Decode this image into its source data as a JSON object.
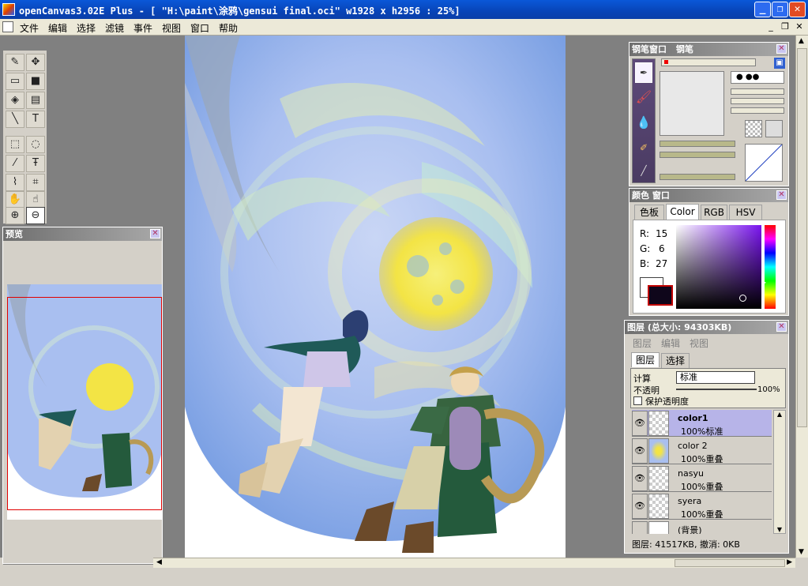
{
  "window": {
    "title": "openCanvas3.02E Plus - [ \"H:\\paint\\涂鸦\\gensui final.oci\" w1928 x h2956 : 25%]"
  },
  "menu": [
    "文件",
    "编辑",
    "选择",
    "滤镜",
    "事件",
    "视图",
    "窗口",
    "帮助"
  ],
  "preview": {
    "title": "预览"
  },
  "brush": {
    "title": "钢笔窗口",
    "tool_name": "钢笔"
  },
  "color": {
    "title": "颜色 窗口",
    "tabs": [
      "色板",
      "Color",
      "RGB",
      "HSV"
    ],
    "selected_tab": "Color",
    "r_label": "R:",
    "r": "15",
    "g_label": "G:",
    "g": "6",
    "b_label": "B:",
    "b": "27",
    "fg_color": "#0f061b",
    "bg_color": "#ffffff"
  },
  "layers": {
    "title": "图层 (总大小: 94303KB)",
    "menu": [
      "图层",
      "编辑",
      "视图"
    ],
    "tabs": [
      "图层",
      "选择"
    ],
    "blend_label": "计算",
    "blend_mode": "标准",
    "opacity_label": "不透明",
    "opacity": "100%",
    "protect_label": "保护透明度",
    "items": [
      {
        "name": "color1",
        "mode": "100%标准",
        "selected": true
      },
      {
        "name": "color 2",
        "mode": "100%重叠",
        "selected": false
      },
      {
        "name": "nasyu",
        "mode": "100%重叠",
        "selected": false
      },
      {
        "name": "syera",
        "mode": "100%重叠",
        "selected": false
      },
      {
        "name": "(背景)",
        "mode": "",
        "selected": false
      }
    ],
    "status": "图层: 41517KB, 撤消: 0KB"
  }
}
